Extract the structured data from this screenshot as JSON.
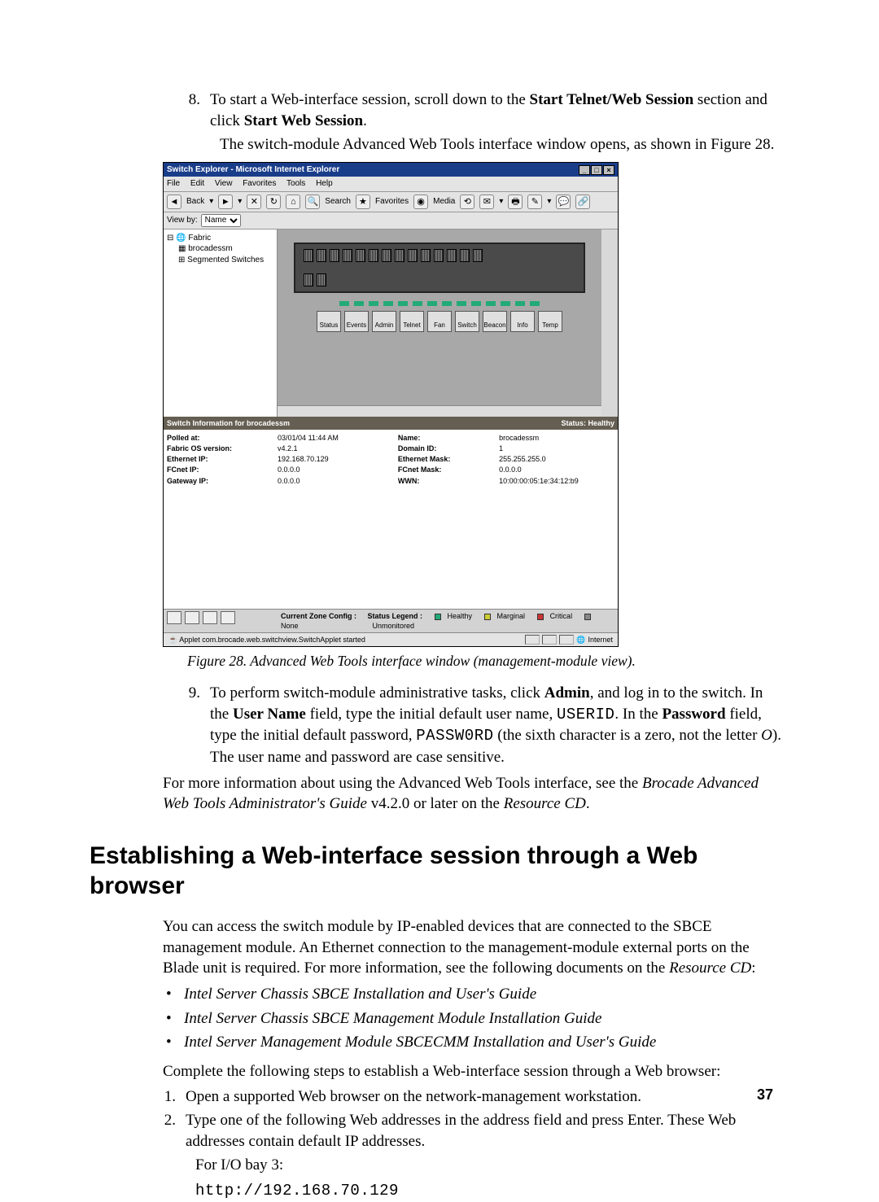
{
  "steps_top": [
    {
      "num": "8.",
      "parts": [
        {
          "t": "text",
          "v": "To start a Web-interface session, scroll down to the "
        },
        {
          "t": "b",
          "v": "Start Telnet/Web Session"
        },
        {
          "t": "text",
          "v": " section and click "
        },
        {
          "t": "b",
          "v": "Start Web Session"
        },
        {
          "t": "text",
          "v": "."
        }
      ],
      "sub": "The switch-module Advanced Web Tools interface window opens, as shown in Figure 28."
    }
  ],
  "fig_caption": "Figure 28.  Advanced Web Tools interface window (management-module view).",
  "step9": {
    "num": "9.",
    "parts": [
      {
        "t": "text",
        "v": "To perform switch-module administrative tasks, click "
      },
      {
        "t": "b",
        "v": "Admin"
      },
      {
        "t": "text",
        "v": ", and log in to the switch. In the "
      },
      {
        "t": "b",
        "v": "User Name"
      },
      {
        "t": "text",
        "v": " field, type the initial default user name, "
      },
      {
        "t": "mono",
        "v": "USERID"
      },
      {
        "t": "text",
        "v": ". In the "
      },
      {
        "t": "b",
        "v": "Password"
      },
      {
        "t": "text",
        "v": " field, type the initial default password, "
      },
      {
        "t": "mono",
        "v": "PASSW0RD"
      },
      {
        "t": "text",
        "v": " (the sixth character is a zero, not the letter "
      },
      {
        "t": "i",
        "v": "O"
      },
      {
        "t": "text",
        "v": "). The user name and password are case sensitive."
      }
    ]
  },
  "moreinfo": [
    {
      "t": "text",
      "v": "For more information about using the Advanced Web Tools interface, see the "
    },
    {
      "t": "i",
      "v": "Brocade Advanced Web Tools Administrator's Guide"
    },
    {
      "t": "text",
      "v": " v4.2.0 or later on the "
    },
    {
      "t": "i",
      "v": "Resource CD"
    },
    {
      "t": "text",
      "v": "."
    }
  ],
  "section_title": "Establishing a Web-interface session through a Web browser",
  "sec_intro": [
    {
      "t": "text",
      "v": "You can access the switch module by IP-enabled devices that are connected to the SBCE management module. An Ethernet connection to the management-module external ports on the Blade unit is required. For more information, see the following documents on the "
    },
    {
      "t": "i",
      "v": "Resource CD"
    },
    {
      "t": "text",
      "v": ":"
    }
  ],
  "bullets": [
    "Intel Server Chassis SBCE Installation and User's Guide",
    "Intel Server Chassis SBCE Management Module Installation Guide",
    "Intel Server Management Module SBCECMM Installation and User's Guide"
  ],
  "complete_line": "Complete the following steps to establish a Web-interface session through a Web browser:",
  "steps_bottom": [
    {
      "num": "1.",
      "text": "Open a supported Web browser on the network-management workstation."
    },
    {
      "num": "2.",
      "text": "Type one of the following Web addresses in the address field and press Enter. These Web addresses contain default IP addresses."
    }
  ],
  "for_io": "For I/O bay 3:",
  "url": "http://192.168.70.129",
  "page_number": "37",
  "shot": {
    "title": "Switch Explorer - Microsoft Internet Explorer",
    "menubar": [
      "File",
      "Edit",
      "View",
      "Favorites",
      "Tools",
      "Help"
    ],
    "toolbar": {
      "back": "Back",
      "search": "Search",
      "favorites": "Favorites",
      "media": "Media"
    },
    "viewby_label": "View by:",
    "viewby_value": "Name",
    "tree": {
      "root": "Fabric",
      "child1": "brocadessm",
      "child2": "Segmented Switches"
    },
    "app_buttons": [
      "Status",
      "Events",
      "Admin",
      "Telnet",
      "Fan",
      "Switch",
      "Beacon",
      "Info",
      "Temp"
    ],
    "info_header_left": "Switch Information for brocadessm",
    "info_header_right": "Status: Healthy",
    "info": [
      {
        "k": "Polled at:",
        "v": "03/01/04 11:44 AM"
      },
      {
        "k": "Name:",
        "v": "brocadessm"
      },
      {
        "k": "Fabric OS version:",
        "v": "v4.2.1"
      },
      {
        "k": "Domain ID:",
        "v": "1"
      },
      {
        "k": "Ethernet IP:",
        "v": "192.168.70.129"
      },
      {
        "k": "Ethernet Mask:",
        "v": "255.255.255.0"
      },
      {
        "k": "FCnet IP:",
        "v": "0.0.0.0"
      },
      {
        "k": "FCnet Mask:",
        "v": "0.0.0.0"
      },
      {
        "k": "Gateway IP:",
        "v": "0.0.0.0"
      },
      {
        "k": "WWN:",
        "v": "10:00:00:05:1e:34:12:b9"
      }
    ],
    "zone_cfg_label": "Current Zone Config :",
    "zone_cfg_value": "None",
    "legend_label": "Status Legend :",
    "legend": [
      "Healthy",
      "Marginal",
      "Critical",
      "Unmonitored"
    ],
    "status_text": "Applet com.brocade.web.switchview.SwitchApplet started",
    "status_right": "Internet"
  }
}
